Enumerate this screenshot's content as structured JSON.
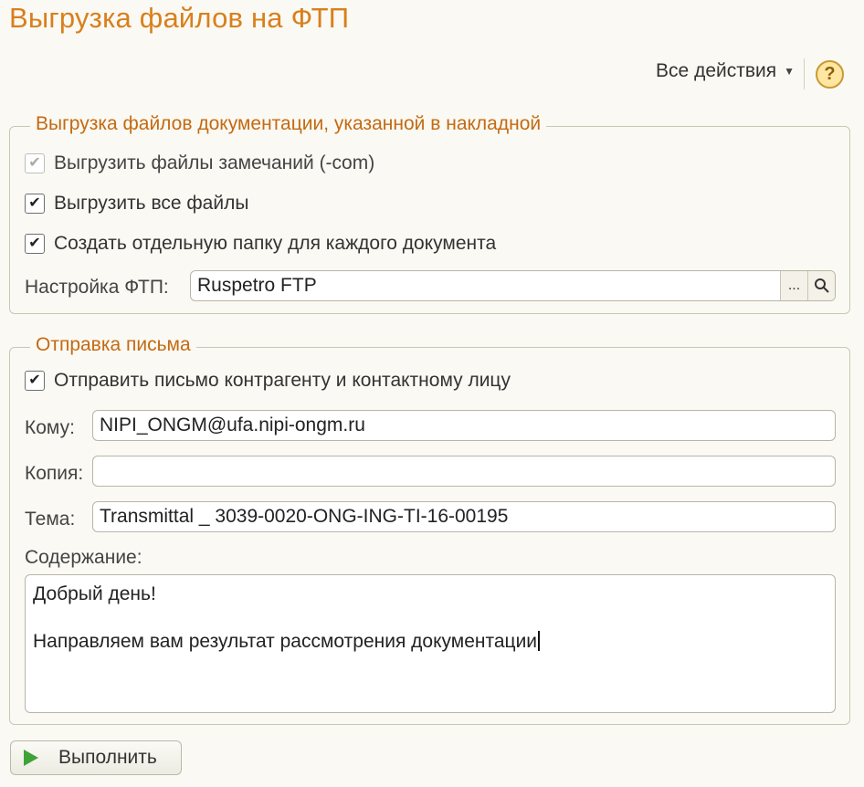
{
  "window": {
    "title": "Выгрузка файлов на ФТП"
  },
  "toolbar": {
    "actions_label": "Все действия",
    "help_label": "?"
  },
  "ftp_group": {
    "title": "Выгрузка файлов документации, указанной в накладной",
    "checkboxes": [
      {
        "label": "Выгрузить файлы замечаний (-com)",
        "checked": true,
        "disabled": true
      },
      {
        "label": "Выгрузить все файлы",
        "checked": true,
        "disabled": false
      },
      {
        "label": "Создать отдельную папку для каждого документа",
        "checked": true,
        "disabled": false
      }
    ],
    "ftp_setting_label": "Настройка ФТП:",
    "ftp_setting_value": "Ruspetro FTP",
    "select_button_label": "...",
    "search_icon": "search-icon"
  },
  "mail_group": {
    "title": "Отправка письма",
    "send_checkbox": {
      "label": "Отправить письмо контрагенту и контактному лицу",
      "checked": true
    },
    "to_label": "Кому:",
    "to_value": "NIPI_ONGM@ufa.nipi-ongm.ru",
    "cc_label": "Копия:",
    "cc_value": "",
    "subject_label": "Тема:",
    "subject_value": "Transmittal _ 3039-0020-ONG-ING-TI-16-00195",
    "content_label": "Содержание:",
    "content_line1": "Добрый день!",
    "content_line2": "Направляем вам результат рассмотрения документации"
  },
  "footer": {
    "run_label": "Выполнить"
  },
  "colors": {
    "title": "#d97f1c",
    "group_title": "#c46a12",
    "run_icon": "#3fa33a"
  }
}
